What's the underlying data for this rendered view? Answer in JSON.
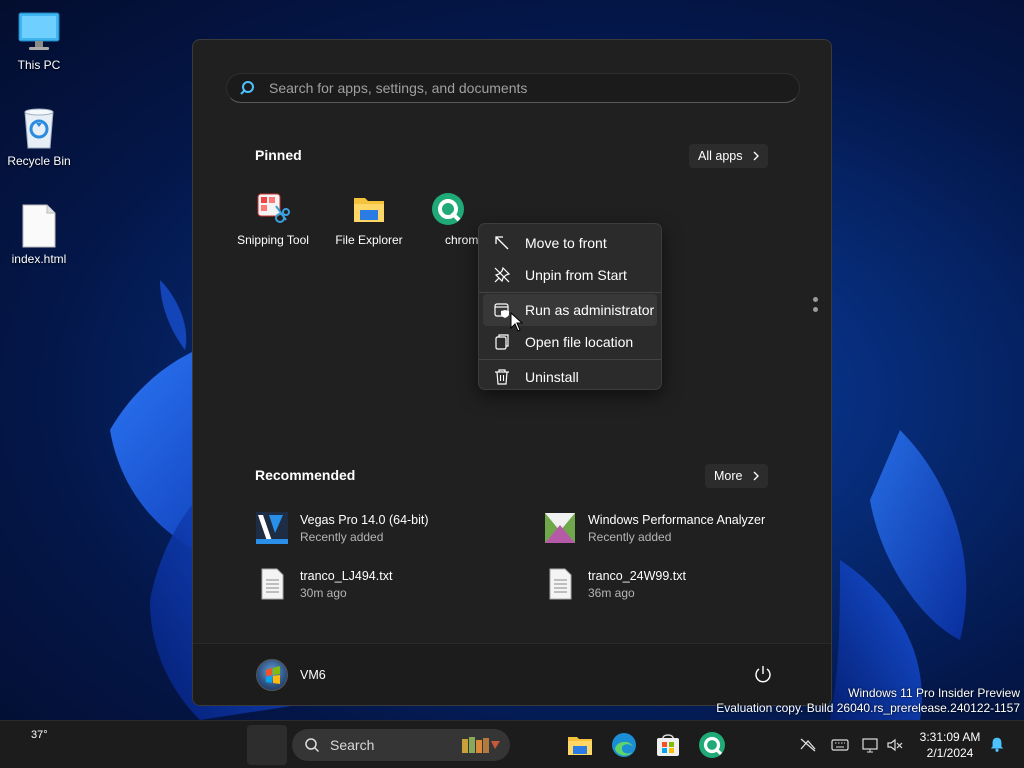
{
  "desktop": {
    "icons": [
      {
        "label": "This PC"
      },
      {
        "label": "Recycle Bin"
      },
      {
        "label": "index.html"
      }
    ]
  },
  "start_menu": {
    "search_placeholder": "Search for apps, settings, and documents",
    "pinned": {
      "title": "Pinned",
      "all_apps_label": "All apps",
      "apps": [
        {
          "label": "Snipping Tool"
        },
        {
          "label": "File Explorer"
        },
        {
          "label": "chrom"
        }
      ]
    },
    "recommended": {
      "title": "Recommended",
      "more_label": "More",
      "items": [
        {
          "name": "Vegas Pro 14.0 (64-bit)",
          "detail": "Recently added"
        },
        {
          "name": "Windows Performance Analyzer",
          "detail": "Recently added"
        },
        {
          "name": "tranco_LJ494.txt",
          "detail": "30m ago"
        },
        {
          "name": "tranco_24W99.txt",
          "detail": "36m ago"
        }
      ]
    },
    "user": {
      "name": "VM6"
    }
  },
  "context_menu": {
    "items": [
      {
        "label": "Move to front"
      },
      {
        "label": "Unpin from Start"
      },
      {
        "label": "Run as administrator"
      },
      {
        "label": "Open file location"
      },
      {
        "label": "Uninstall"
      }
    ]
  },
  "watermark": {
    "line1": "Windows 11 Pro Insider Preview",
    "line2": "Evaluation copy. Build 26040.rs_prerelease.240122-1157"
  },
  "taskbar": {
    "weather": "37°",
    "search_label": "Search",
    "time": "3:31:09 AM",
    "date": "2/1/2024"
  },
  "colors": {
    "accent": "#4cc2ff",
    "menu_bg": "#202020",
    "context_bg": "#2b2b2b",
    "taskbar_bg": "#1c1c1c"
  }
}
